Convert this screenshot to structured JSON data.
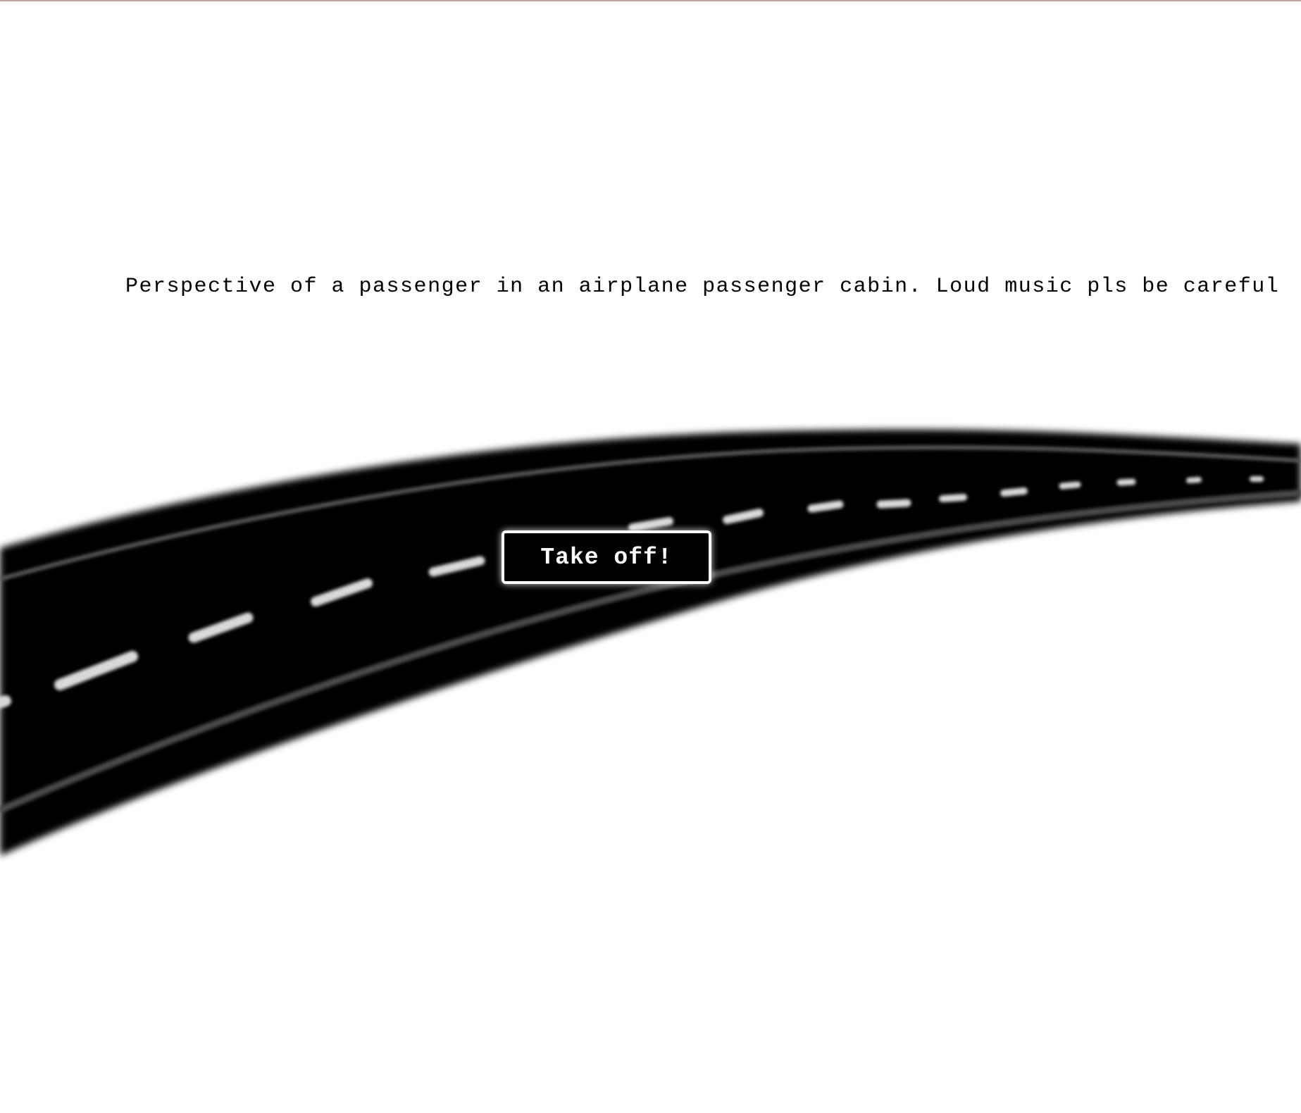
{
  "caption": "Perspective of a passenger in an airplane passenger cabin. Loud music pls be careful",
  "button": {
    "label": "Take off!"
  },
  "colors": {
    "background": "#ffffff",
    "runway": "#000000",
    "runway_markings": "#d9d9d9",
    "button_background": "#000000",
    "button_border": "#ffffff",
    "text": "#000000"
  }
}
